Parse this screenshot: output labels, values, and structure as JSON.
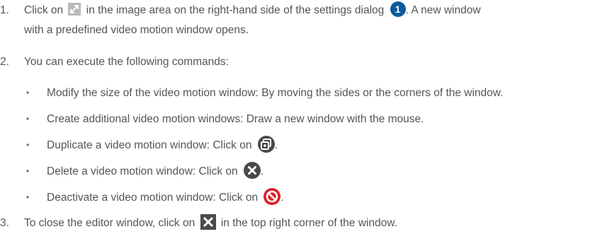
{
  "steps": [
    {
      "num": "1.",
      "line1a": "Click on",
      "line1b": "in the image area on the right-hand side of the settings dialog",
      "callout": "1",
      "line1c": ". A new window",
      "line2": "with a predefined video motion window opens."
    },
    {
      "num": "2.",
      "text": "You can execute the following commands:"
    },
    {
      "num": "3.",
      "texta": "To close the editor window, click on",
      "textb": "in the top right corner of the window."
    }
  ],
  "bullets": [
    {
      "text": "Modify the size of the video motion window: By moving the sides or the corners of the window."
    },
    {
      "text": "Create additional video motion windows: Draw a new window with the mouse."
    },
    {
      "text": "Duplicate a video motion window: Click on",
      "icon": "duplicate-icon",
      "after": "."
    },
    {
      "text": "Delete a video motion window: Click on",
      "icon": "delete-circle-icon",
      "after": "."
    },
    {
      "text": "Deactivate a video motion window: Click on",
      "icon": "deactivate-icon",
      "after": "."
    }
  ],
  "bullet_char": "•",
  "colors": {
    "text": "#555555",
    "callout": "#0d5a9e",
    "icon": "#4a4a4a",
    "deactivate": "#d9222a",
    "expand": "#b9b9b9"
  }
}
